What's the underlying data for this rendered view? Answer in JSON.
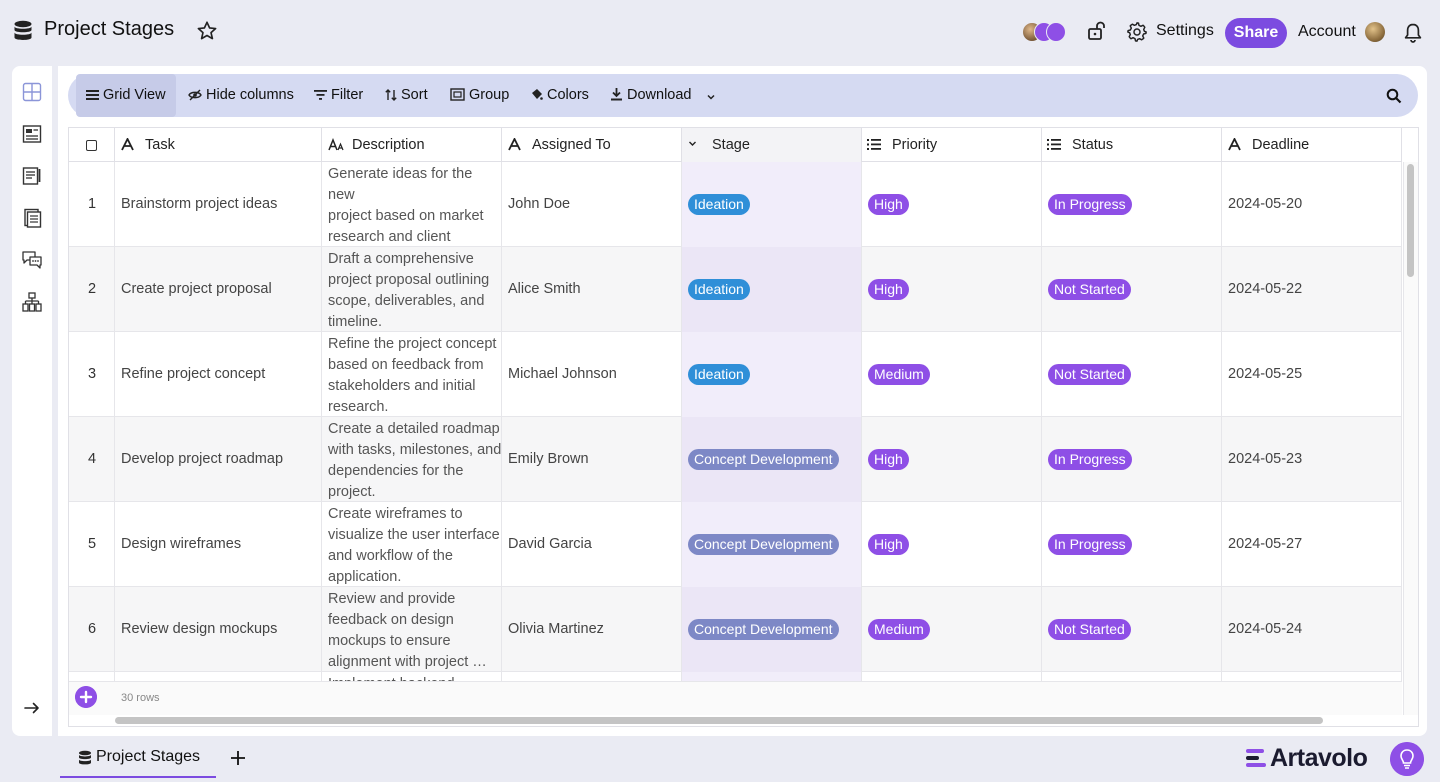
{
  "app": {
    "title": "Project Stages",
    "brand": "Artavolo",
    "accent_color": "#7c4be0"
  },
  "header": {
    "settings_label": "Settings",
    "share_label": "Share",
    "account_label": "Account"
  },
  "sidebar": {
    "items": [
      {
        "icon": "grid-view-icon"
      },
      {
        "icon": "form-view-icon"
      },
      {
        "icon": "kanban-view-icon"
      },
      {
        "icon": "document-view-icon"
      },
      {
        "icon": "chat-view-icon"
      },
      {
        "icon": "org-chart-icon"
      }
    ]
  },
  "toolbar": {
    "grid_view": "Grid View",
    "hide_columns": "Hide columns",
    "filter": "Filter",
    "sort": "Sort",
    "group": "Group",
    "colors": "Colors",
    "download": "Download"
  },
  "table": {
    "columns": [
      "Task",
      "Description",
      "Assigned To",
      "Stage",
      "Priority",
      "Status",
      "Deadline"
    ],
    "rows": [
      {
        "num": "1",
        "task": "Brainstorm project ideas",
        "description": "Generate ideas for the new\nproject based on market\nresearch and client\nrequirements.",
        "assigned": "John Doe",
        "stage": "Ideation",
        "priority": "High",
        "status": "In Progress",
        "deadline": "2024-05-20"
      },
      {
        "num": "2",
        "task": "Create project proposal",
        "description": "Draft a comprehensive\nproject proposal outlining\nscope, deliverables, and\ntimeline.",
        "assigned": "Alice Smith",
        "stage": "Ideation",
        "priority": "High",
        "status": "Not Started",
        "deadline": "2024-05-22"
      },
      {
        "num": "3",
        "task": "Refine project concept",
        "description": "Refine the project concept\nbased on feedback from\nstakeholders and initial\nresearch.",
        "assigned": "Michael Johnson",
        "stage": "Ideation",
        "priority": "Medium",
        "status": "Not Started",
        "deadline": "2024-05-25"
      },
      {
        "num": "4",
        "task": "Develop project roadmap",
        "description": "Create a detailed roadmap\nwith tasks, milestones, and\ndependencies for the\nproject.",
        "assigned": "Emily Brown",
        "stage": "Concept Development",
        "priority": "High",
        "status": "In Progress",
        "deadline": "2024-05-23"
      },
      {
        "num": "5",
        "task": "Design wireframes",
        "description": "Create wireframes to\nvisualize the user interface\nand workflow of the\napplication.",
        "assigned": "David Garcia",
        "stage": "Concept Development",
        "priority": "High",
        "status": "In Progress",
        "deadline": "2024-05-27"
      },
      {
        "num": "6",
        "task": "Review design mockups",
        "description": "Review and provide\nfeedback on design\nmockups to ensure\nalignment with project …",
        "assigned": "Olivia Martinez",
        "stage": "Concept Development",
        "priority": "Medium",
        "status": "Not Started",
        "deadline": "2024-05-24"
      },
      {
        "num": "",
        "task": "",
        "description": "Implement backend",
        "assigned": "",
        "stage": "",
        "priority": "",
        "status": "",
        "deadline": ""
      }
    ],
    "row_count_label": "30 rows",
    "stage_colors": {
      "Ideation": "#2f8fd8",
      "Concept Development": "#7d88c6"
    },
    "priority_color": "#8e4fe6",
    "status_color": "#8e4fe6"
  },
  "bottom": {
    "sheet_tab": "Project Stages"
  }
}
